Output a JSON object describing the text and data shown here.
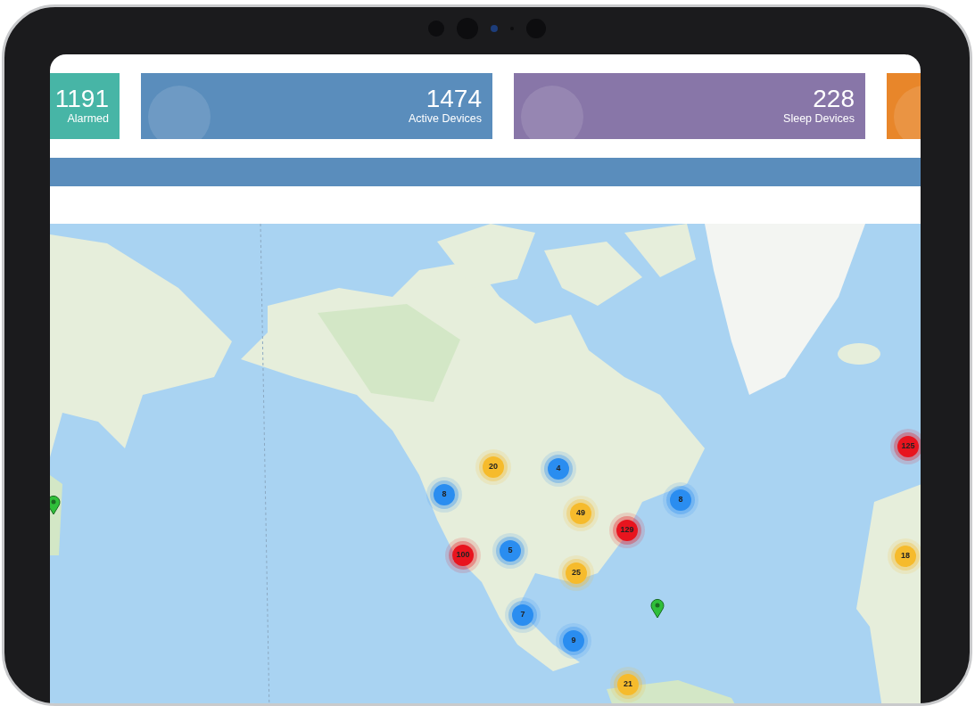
{
  "stat_cards": [
    {
      "value": "1191",
      "label": "Alarmed",
      "color": "#47b5a6"
    },
    {
      "value": "1474",
      "label": "Active Devices",
      "color": "#5a8dbc"
    },
    {
      "value": "228",
      "label": "Sleep Devices",
      "color": "#8876a8"
    },
    {
      "color": "#e8862a"
    }
  ],
  "map": {
    "markers": [
      {
        "kind": "cluster",
        "count": "20",
        "color": "#f6bb2c"
      },
      {
        "kind": "cluster",
        "count": "4",
        "color": "#2a8df0"
      },
      {
        "kind": "cluster",
        "count": "8",
        "color": "#2a8df0"
      },
      {
        "kind": "cluster",
        "count": "49",
        "color": "#f6bb2c"
      },
      {
        "kind": "cluster",
        "count": "129",
        "color": "#e8141e"
      },
      {
        "kind": "cluster",
        "count": "100",
        "color": "#e8141e"
      },
      {
        "kind": "cluster",
        "count": "5",
        "color": "#2a8df0"
      },
      {
        "kind": "cluster",
        "count": "8",
        "color": "#2a8df0"
      },
      {
        "kind": "cluster",
        "count": "25",
        "color": "#f6bb2c"
      },
      {
        "kind": "cluster",
        "count": "7",
        "color": "#2a8df0"
      },
      {
        "kind": "cluster",
        "count": "9",
        "color": "#2a8df0"
      },
      {
        "kind": "cluster",
        "count": "21",
        "color": "#f6bb2c"
      },
      {
        "kind": "cluster",
        "count": "125",
        "color": "#e8141e"
      },
      {
        "kind": "cluster",
        "count": "18",
        "color": "#f6bb2c"
      },
      {
        "kind": "pin",
        "color": "#2fbf3a"
      },
      {
        "kind": "pin",
        "color": "#2fbf3a"
      }
    ]
  }
}
